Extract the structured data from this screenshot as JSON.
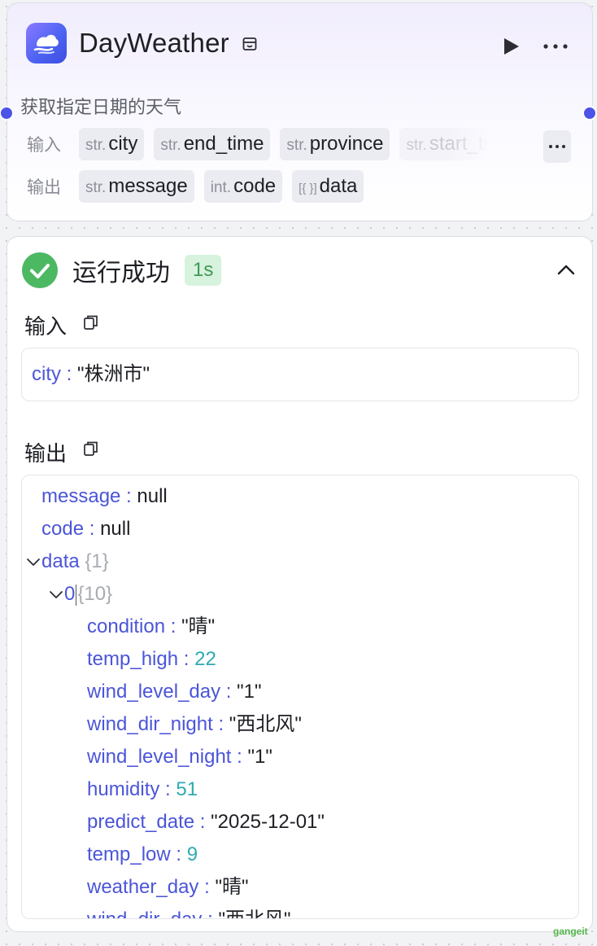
{
  "node": {
    "title": "DayWeather",
    "description": "获取指定日期的天气",
    "inputs_label": "输入",
    "outputs_label": "输出",
    "inputs": [
      {
        "type": "str.",
        "name": "city"
      },
      {
        "type": "str.",
        "name": "end_time"
      },
      {
        "type": "str.",
        "name": "province"
      },
      {
        "type": "str.",
        "name": "start_time"
      }
    ],
    "outputs": [
      {
        "type": "str.",
        "name": "message"
      },
      {
        "type": "int.",
        "name": "code"
      },
      {
        "type": "[{ }]",
        "name": "data"
      }
    ],
    "more_label": "···"
  },
  "result": {
    "status": "运行成功",
    "duration": "1s",
    "input_title": "输入",
    "output_title": "输出",
    "input": {
      "key": "city",
      "sep": " : ",
      "value": "\"株洲市\""
    },
    "output": {
      "message": {
        "key": "message",
        "sep": " : ",
        "value": "null"
      },
      "code": {
        "key": "code",
        "sep": " : ",
        "value": "null"
      },
      "data": {
        "key": "data",
        "count": "{1}"
      },
      "item": {
        "key": "0",
        "count": "{10}"
      },
      "fields": [
        {
          "key": "condition",
          "value": "\"晴\"",
          "kind": "str"
        },
        {
          "key": "temp_high",
          "value": "22",
          "kind": "num"
        },
        {
          "key": "wind_level_day",
          "value": "\"1\"",
          "kind": "str"
        },
        {
          "key": "wind_dir_night",
          "value": "\"西北风\"",
          "kind": "str"
        },
        {
          "key": "wind_level_night",
          "value": "\"1\"",
          "kind": "str"
        },
        {
          "key": "humidity",
          "value": "51",
          "kind": "num"
        },
        {
          "key": "predict_date",
          "value": "\"2025-12-01\"",
          "kind": "str"
        },
        {
          "key": "temp_low",
          "value": "9",
          "kind": "num"
        },
        {
          "key": "weather_day",
          "value": "\"晴\"",
          "kind": "str"
        },
        {
          "key": "wind_dir_day",
          "value": "\"西北风\"",
          "kind": "str"
        }
      ]
    }
  },
  "watermark": "gangeit",
  "colors": {
    "accent": "#4d53e8",
    "key": "#4b55d8",
    "number": "#2eaab1",
    "success": "#4cb862",
    "badge_bg": "#d7f2dd"
  }
}
